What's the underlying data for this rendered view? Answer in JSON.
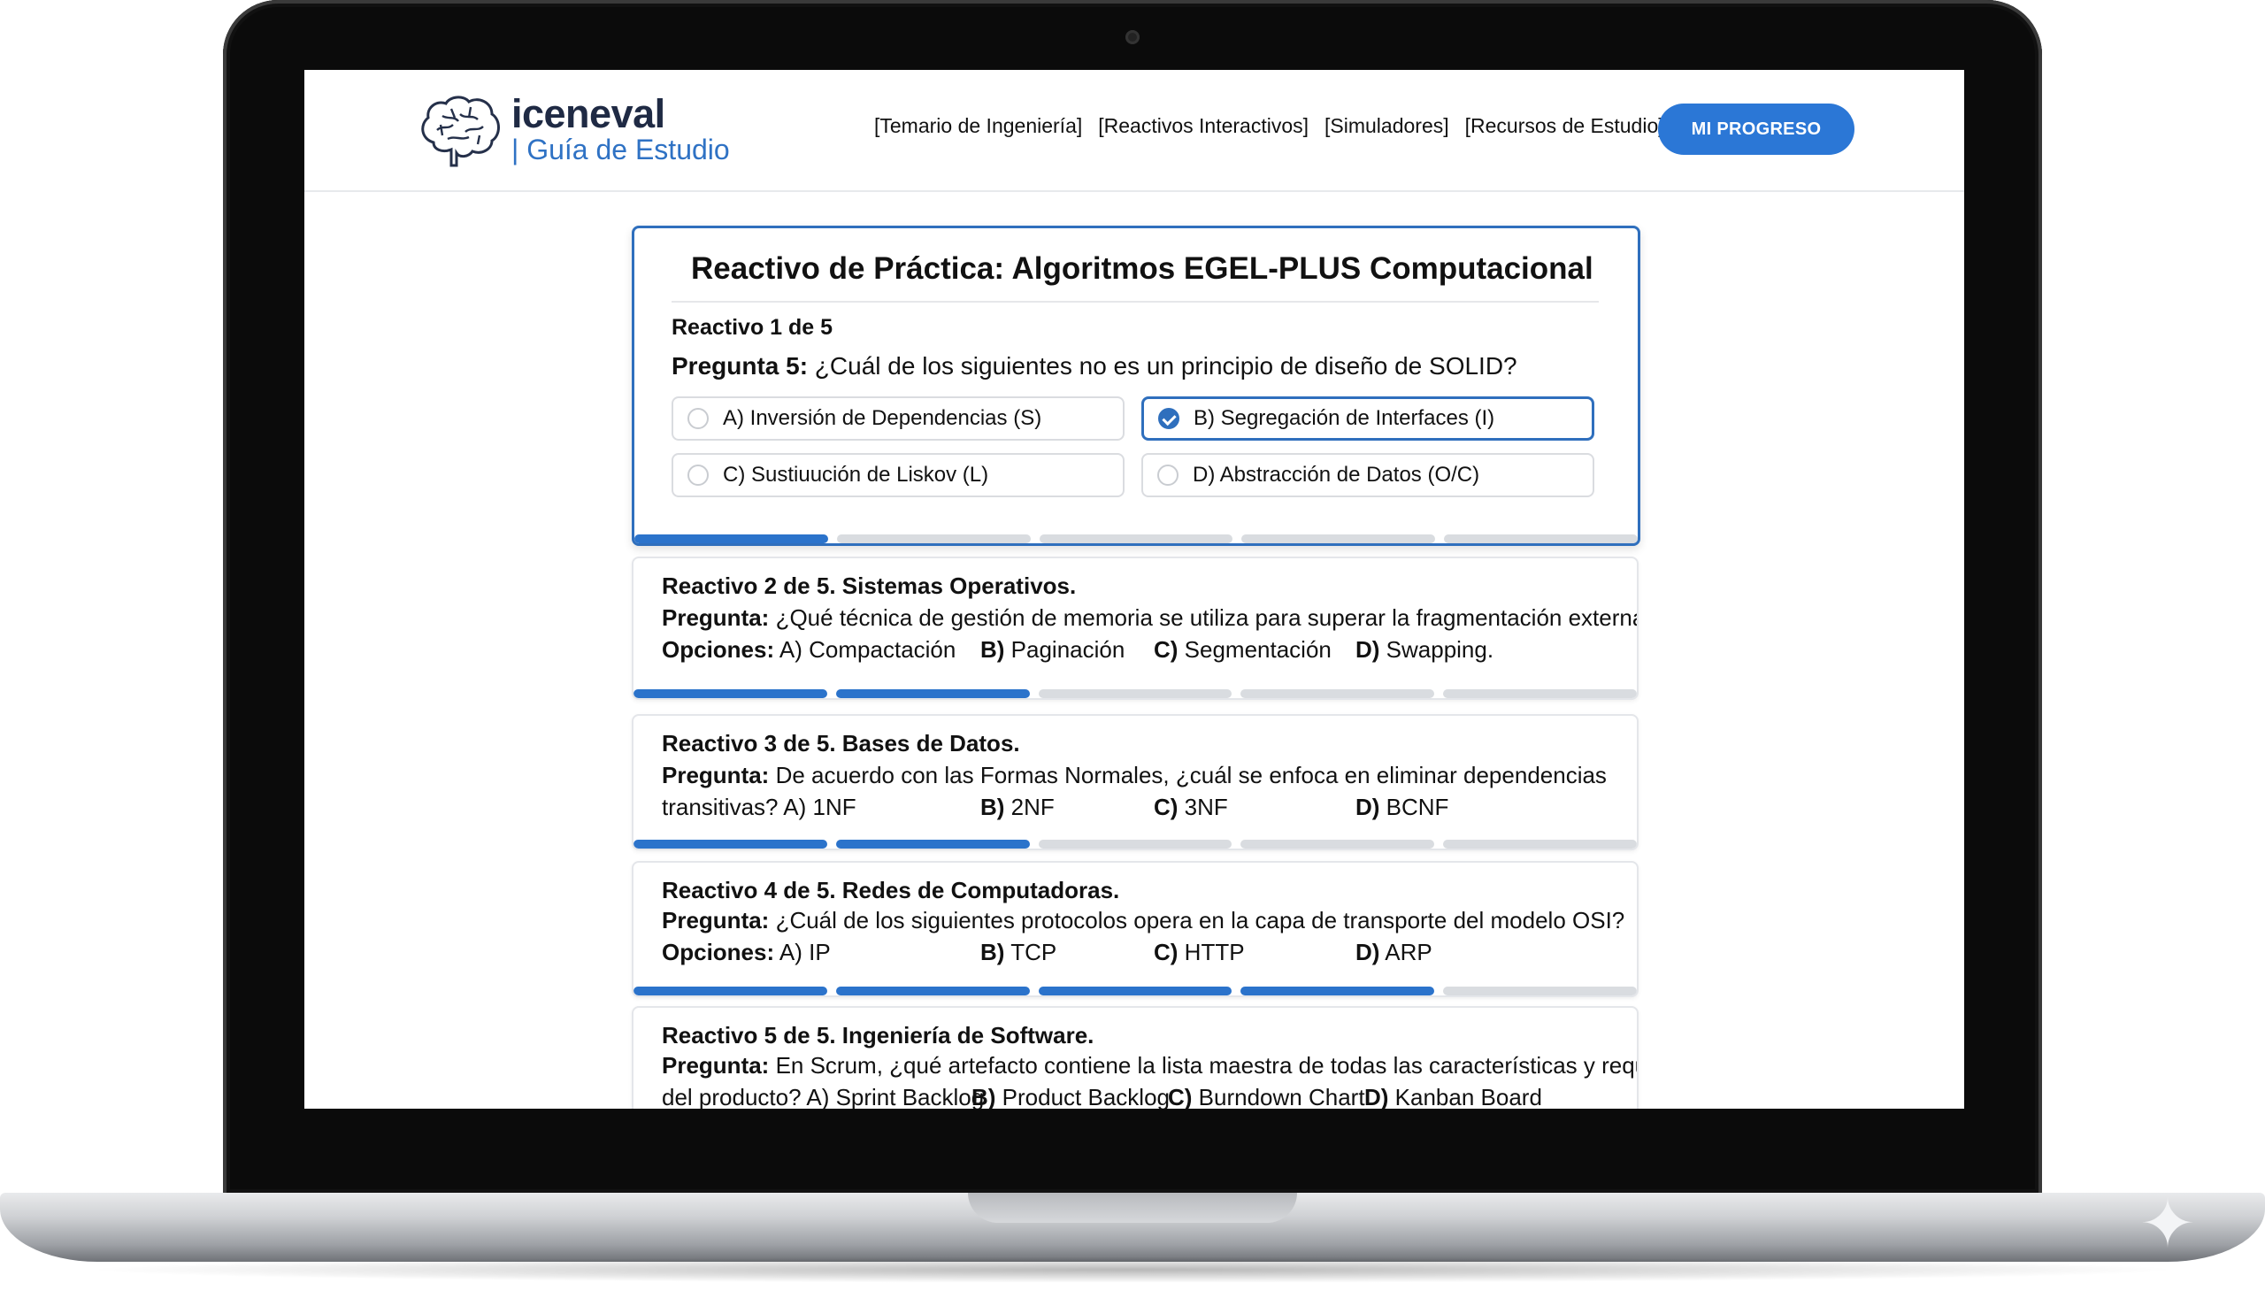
{
  "brand": {
    "name": "iceneval",
    "subtitle": "| Guía de Estudio",
    "logo_icon": "brain-icon"
  },
  "nav": {
    "items": [
      "[Temario de Ingeniería]",
      "[Reactivos Interactivos]",
      "[Simuladores]",
      "[Recursos de Estudio]"
    ],
    "progress_button": "MI PROGRESO"
  },
  "featured": {
    "title": "Reactivo de Práctica: Algoritmos EGEL-PLUS Computacional",
    "counter": "Reactivo 1 de 5",
    "question_label": "Pregunta 5:",
    "question_text": " ¿Cuál de los siguientes no es un principio de diseño de SOLID?",
    "options": [
      "A) Inversión de Dependencias (S)",
      "B) Segregación de Interfaces (I)",
      "C) Sustiuución de Liskov (L)",
      "D) Abstracción de Datos (O/C)"
    ],
    "selected_option": 1,
    "progress_segments": 5,
    "progress_done": 1
  },
  "items": [
    {
      "heading": "Reactivo 2 de 5. Sistemas Operativos.",
      "question_label": "Pregunta:",
      "question_text": " ¿Qué técnica de gestión de memoria se utiliza para superar la fragmentación externa?",
      "options_label": "Opciones:",
      "opt_a": " A) Compactación",
      "opt_b_key": "B)",
      "opt_b": " Paginación",
      "opt_c_key": "C)",
      "opt_c": " Segmentación",
      "opt_d_key": "D)",
      "opt_d": " Swapping.",
      "progress_done": 2
    },
    {
      "heading": "Reactivo 3 de 5. Bases de Datos.",
      "question_label": "Pregunta:",
      "question_text": " De acuerdo con las Formas Normales, ¿cuál se enfoca en eliminar dependencias",
      "question_cont": "transitivas? A) 1NF",
      "opt_b_key": "B)",
      "opt_b": " 2NF",
      "opt_c_key": "C)",
      "opt_c": " 3NF",
      "opt_d_key": "D)",
      "opt_d": " BCNF",
      "progress_done": 2
    },
    {
      "heading": "Reactivo 4 de 5. Redes de Computadoras.",
      "question_label": "Pregunta:",
      "question_text": " ¿Cuál de los siguientes protocolos opera en la capa de transporte del modelo OSI?",
      "options_label": "Opciones:",
      "opt_a": " A) IP",
      "opt_b_key": "B)",
      "opt_b": " TCP",
      "opt_c_key": "C)",
      "opt_c": " HTTP",
      "opt_d_key": "D)",
      "opt_d": " ARP",
      "progress_done": 4
    },
    {
      "heading": "Reactivo 5 de 5. Ingeniería de Software.",
      "question_label": "Pregunta:",
      "question_text": " En Scrum, ¿qué artefacto contiene la lista maestra de todas las características y requisitos",
      "question_cont": "del producto? A) Sprint Backlog",
      "opt_b_key": "B)",
      "opt_b": " Product Backlog",
      "opt_c_key": "C)",
      "opt_c": " Burndown Chart",
      "opt_d_key": "D)",
      "opt_d": " Kanban Board"
    }
  ],
  "colors": {
    "accent": "#2b77d6",
    "brand_dark": "#1f2a44",
    "progress_done": "#2b73cb",
    "progress_todo": "#d9dce0"
  }
}
